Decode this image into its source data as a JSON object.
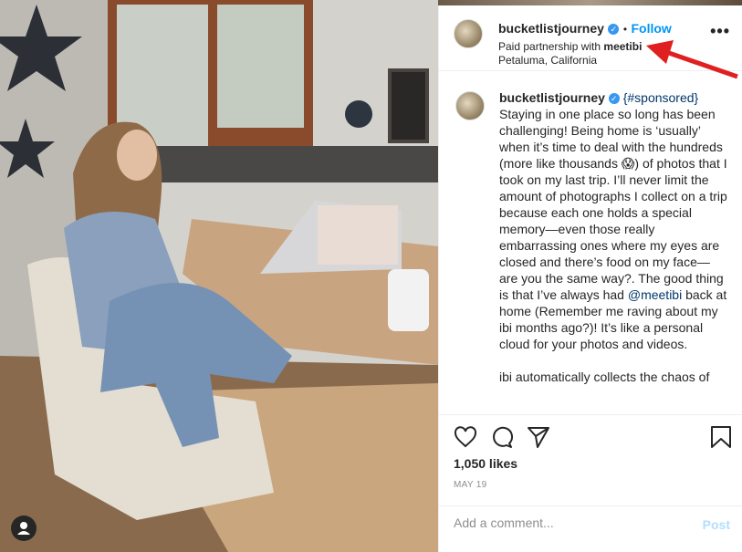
{
  "post": {
    "username": "bucketlistjourney",
    "separator": "•",
    "follow_label": "Follow",
    "partnership_prefix": "Paid partnership with ",
    "partner": "meetibi",
    "location": "Petaluma, California",
    "more_label": "•••",
    "caption": {
      "username": "bucketlistjourney",
      "hashtag": "{#sponsored}",
      "text_1": "Staying in one place so long has been challenging! Being home is ‘usually’ when it’s time to deal with the hundreds (more like thousands 😱) of photos that I took on my last trip. I’ll never limit the amount of photographs I collect on a trip because each one holds a special memory—even those really embarrassing ones where my eyes are closed and there’s food on my face—are you the same way?. The good thing is that I’ve always had ",
      "mention": "@meetibi",
      "text_2": " back at home (Remember me raving about my ibi months ago?)! It’s like a personal cloud for your photos and videos.",
      "text_3": "ibi automatically collects the chaos of"
    },
    "likes": "1,050 likes",
    "date": "MAY 19",
    "comment_placeholder": "Add a comment...",
    "post_label": "Post"
  },
  "colors": {
    "accent": "#0095f6",
    "annotation_arrow": "#e02020"
  },
  "icons": [
    "heart-icon",
    "comment-icon",
    "share-icon",
    "bookmark-icon",
    "more-icon",
    "verified-icon",
    "user-icon"
  ]
}
